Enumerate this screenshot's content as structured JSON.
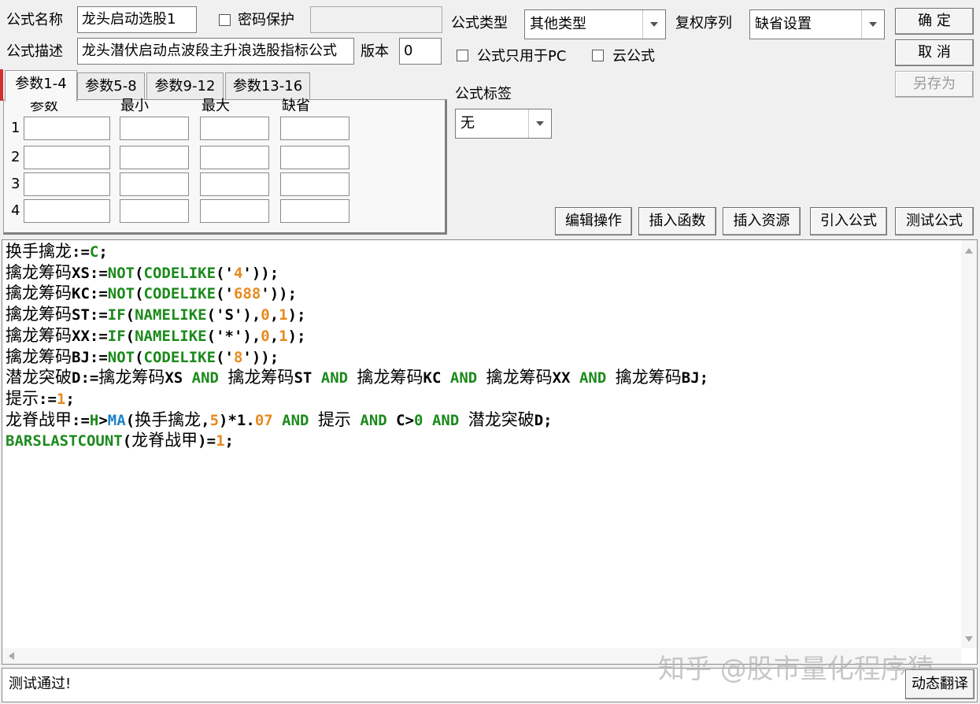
{
  "formula": {
    "name_label": "公式名称",
    "name_value": "龙头启动选股1",
    "password_label": "密码保护",
    "desc_label": "公式描述",
    "desc_value": "龙头潜伏启动点波段主升浪选股指标公式",
    "version_label": "版本",
    "version_value": "0",
    "type_label": "公式类型",
    "type_value": "其他类型",
    "rights_label": "复权序列",
    "rights_value": "缺省设置",
    "pc_only_label": "公式只用于PC",
    "cloud_label": "云公式",
    "tag_label": "公式标签",
    "tag_value": "无"
  },
  "buttons": {
    "ok": "确 定",
    "cancel": "取 消",
    "save_as": "另存为",
    "edit_ops": "编辑操作",
    "insert_func": "插入函数",
    "insert_res": "插入资源",
    "import_formula": "引入公式",
    "test_formula": "测试公式",
    "dynamic_translate": "动态翻译"
  },
  "tabs": [
    "参数1-4",
    "参数5-8",
    "参数9-12",
    "参数13-16"
  ],
  "params": {
    "headers": [
      "参数",
      "最小",
      "最大",
      "缺省"
    ],
    "rows": [
      "1",
      "2",
      "3",
      "4"
    ]
  },
  "code_lines": [
    [
      [
        "cn",
        "换手擒龙"
      ],
      [
        "p",
        ":="
      ],
      [
        "fn",
        "C"
      ],
      [
        "p",
        ";"
      ]
    ],
    [
      [
        "cn",
        "擒龙筹码"
      ],
      [
        "p",
        "XS:="
      ],
      [
        "fn",
        "NOT"
      ],
      [
        "p",
        "("
      ],
      [
        "fn",
        "CODELIKE"
      ],
      [
        "p",
        "('"
      ],
      [
        "num",
        "4"
      ],
      [
        "p",
        "'));"
      ]
    ],
    [
      [
        "cn",
        "擒龙筹码"
      ],
      [
        "p",
        "KC:="
      ],
      [
        "fn",
        "NOT"
      ],
      [
        "p",
        "("
      ],
      [
        "fn",
        "CODELIKE"
      ],
      [
        "p",
        "('"
      ],
      [
        "num",
        "688"
      ],
      [
        "p",
        "'));"
      ]
    ],
    [
      [
        "cn",
        "擒龙筹码"
      ],
      [
        "p",
        "ST:="
      ],
      [
        "fn",
        "IF"
      ],
      [
        "p",
        "("
      ],
      [
        "fn",
        "NAMELIKE"
      ],
      [
        "p",
        "('S'),"
      ],
      [
        "num",
        "0"
      ],
      [
        "p",
        ","
      ],
      [
        "num",
        "1"
      ],
      [
        "p",
        ");"
      ]
    ],
    [
      [
        "cn",
        "擒龙筹码"
      ],
      [
        "p",
        "XX:="
      ],
      [
        "fn",
        "IF"
      ],
      [
        "p",
        "("
      ],
      [
        "fn",
        "NAMELIKE"
      ],
      [
        "p",
        "('*'),"
      ],
      [
        "num",
        "0"
      ],
      [
        "p",
        ","
      ],
      [
        "num",
        "1"
      ],
      [
        "p",
        ");"
      ]
    ],
    [
      [
        "cn",
        "擒龙筹码"
      ],
      [
        "p",
        "BJ:="
      ],
      [
        "fn",
        "NOT"
      ],
      [
        "p",
        "("
      ],
      [
        "fn",
        "CODELIKE"
      ],
      [
        "p",
        "('"
      ],
      [
        "num",
        "8"
      ],
      [
        "p",
        "'));"
      ]
    ],
    [
      [
        "cn",
        "潜龙突破"
      ],
      [
        "p",
        "D:="
      ],
      [
        "cn",
        "擒龙筹码"
      ],
      [
        "p",
        "XS "
      ],
      [
        "kw",
        "AND"
      ],
      [
        "p",
        " "
      ],
      [
        "cn",
        "擒龙筹码"
      ],
      [
        "p",
        "ST "
      ],
      [
        "kw",
        "AND"
      ],
      [
        "p",
        " "
      ],
      [
        "cn",
        "擒龙筹码"
      ],
      [
        "p",
        "KC "
      ],
      [
        "kw",
        "AND"
      ],
      [
        "p",
        " "
      ],
      [
        "cn",
        "擒龙筹码"
      ],
      [
        "p",
        "XX "
      ],
      [
        "kw",
        "AND"
      ],
      [
        "p",
        " "
      ],
      [
        "cn",
        "擒龙筹码"
      ],
      [
        "p",
        "BJ;"
      ]
    ],
    [
      [
        "cn",
        "提示"
      ],
      [
        "p",
        ":="
      ],
      [
        "num",
        "1"
      ],
      [
        "p",
        ";"
      ]
    ],
    [
      [
        "cn",
        "龙脊战甲"
      ],
      [
        "p",
        ":="
      ],
      [
        "fn",
        "H"
      ],
      [
        "p",
        ">"
      ],
      [
        "blue",
        "MA"
      ],
      [
        "p",
        "("
      ],
      [
        "cn",
        "换手擒龙"
      ],
      [
        "p",
        ","
      ],
      [
        "num",
        "5"
      ],
      [
        "p",
        ")*1."
      ],
      [
        "num",
        "07"
      ],
      [
        "p",
        " "
      ],
      [
        "kw",
        "AND"
      ],
      [
        "p",
        " "
      ],
      [
        "cn",
        "提示"
      ],
      [
        "p",
        " "
      ],
      [
        "kw",
        "AND"
      ],
      [
        "p",
        " C>"
      ],
      [
        "fn",
        "0"
      ],
      [
        "p",
        " "
      ],
      [
        "kw",
        "AND"
      ],
      [
        "p",
        " "
      ],
      [
        "cn",
        "潜龙突破"
      ],
      [
        "p",
        "D;"
      ]
    ],
    [
      [
        "fn",
        "BARSLASTCOUNT"
      ],
      [
        "p",
        "("
      ],
      [
        "cn",
        "龙脊战甲"
      ],
      [
        "p",
        ")="
      ],
      [
        "num",
        "1"
      ],
      [
        "p",
        ";"
      ]
    ]
  ],
  "status_text": "测试通过!",
  "watermark": "知乎 @股市量化程序猿",
  "colors": {
    "function": "#1c8a1c",
    "number": "#e88a20",
    "ma": "#1c82c8"
  }
}
